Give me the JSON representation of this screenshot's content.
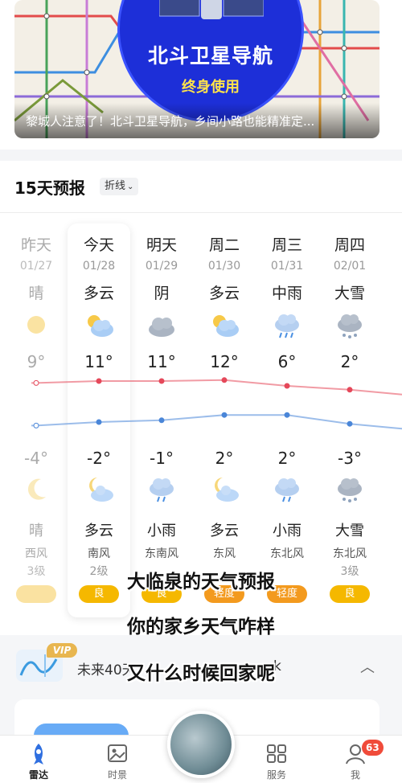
{
  "banner": {
    "title": "北斗卫星导航",
    "subtitle": "终身使用",
    "caption": "黎城人注意了！北斗卫星导航，乡间小路也能精准定..."
  },
  "forecast": {
    "title": "15天预报",
    "mode_label": "折线",
    "days": [
      {
        "day": "昨天",
        "date": "01/27",
        "day_cond": "晴",
        "day_icon": "sun",
        "high": "9°",
        "low": "-4°",
        "night_icon": "moon",
        "night_cond": "晴",
        "wind": "西风",
        "wind_level": "3级",
        "aqi": "",
        "aqi_color": "#f5c544"
      },
      {
        "day": "今天",
        "date": "01/28",
        "day_cond": "多云",
        "day_icon": "partly-cloudy",
        "high": "11°",
        "low": "-2°",
        "night_icon": "moon-cloudy",
        "night_cond": "多云",
        "wind": "南风",
        "wind_level": "2级",
        "aqi": "良",
        "aqi_color": "#f5b800"
      },
      {
        "day": "明天",
        "date": "01/29",
        "day_cond": "阴",
        "day_icon": "overcast",
        "high": "11°",
        "low": "-1°",
        "night_icon": "light-rain",
        "night_cond": "小雨",
        "wind": "东南风",
        "wind_level": "",
        "aqi": "良",
        "aqi_color": "#f5b800"
      },
      {
        "day": "周二",
        "date": "01/30",
        "day_cond": "多云",
        "day_icon": "partly-cloudy",
        "high": "12°",
        "low": "2°",
        "night_icon": "moon-cloudy",
        "night_cond": "多云",
        "wind": "东风",
        "wind_level": "",
        "aqi": "轻度",
        "aqi_color": "#f39a1e"
      },
      {
        "day": "周三",
        "date": "01/31",
        "day_cond": "中雨",
        "day_icon": "moderate-rain",
        "high": "6°",
        "low": "2°",
        "night_icon": "light-rain",
        "night_cond": "小雨",
        "wind": "东北风",
        "wind_level": "",
        "aqi": "轻度",
        "aqi_color": "#f39a1e"
      },
      {
        "day": "周四",
        "date": "02/01",
        "day_cond": "大雪",
        "day_icon": "heavy-snow",
        "high": "2°",
        "low": "-3°",
        "night_icon": "heavy-snow",
        "night_cond": "大雪",
        "wind": "东北风",
        "wind_level": "3级",
        "aqi": "良",
        "aqi_color": "#f5b800"
      }
    ],
    "high_line_color": "#e5485a",
    "low_line_color": "#4a86d8"
  },
  "subtitles": {
    "line1": "大临泉的天气预报",
    "line2": "你的家乡天气咋样",
    "line3": "又什么时候回家呢"
  },
  "forty_day": {
    "vip_label": "VIP",
    "label": "未来40天",
    "tail": "k",
    "collapse_icon": "chevron-up-icon"
  },
  "tabbar": {
    "tabs": [
      {
        "label": "雷达",
        "icon": "rocket-icon",
        "active": true
      },
      {
        "label": "时景",
        "icon": "photo-icon",
        "active": false
      },
      {
        "label": "服务",
        "icon": "grid-icon",
        "active": false
      },
      {
        "label": "我",
        "icon": "user-icon",
        "active": false
      }
    ],
    "badge_count": "63"
  }
}
